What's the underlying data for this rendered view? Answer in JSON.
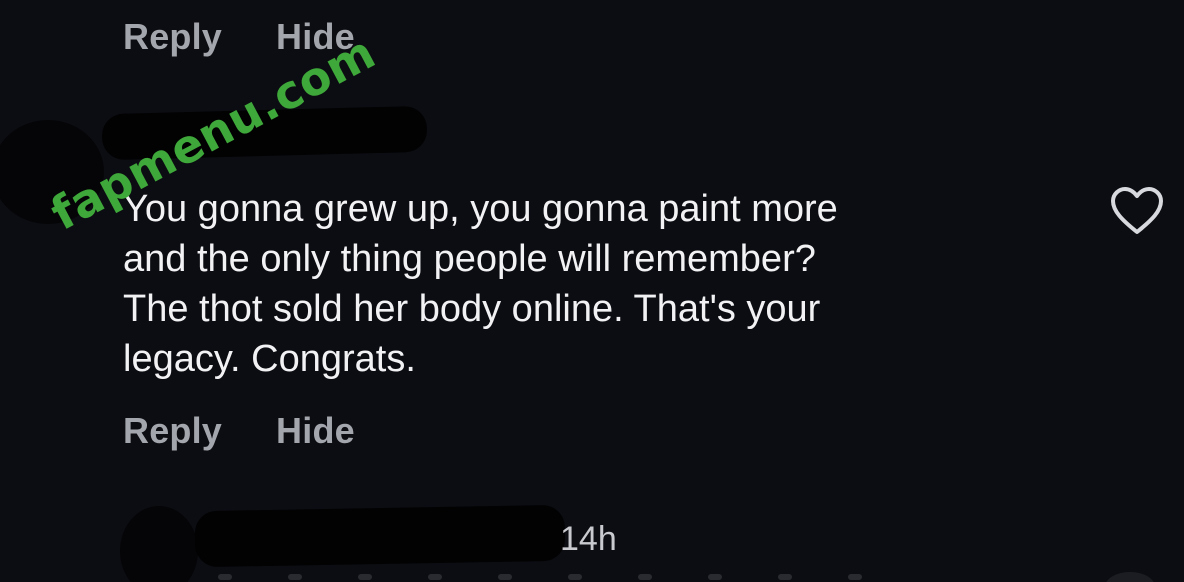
{
  "actions_top": {
    "reply": "Reply",
    "hide": "Hide"
  },
  "comment": {
    "text": "You gonna grew up, you gonna paint more\nand the only thing people will remember?\nThe thot sold her body online. That's your\nlegacy. Congrats."
  },
  "actions_mid": {
    "reply": "Reply",
    "hide": "Hide"
  },
  "next_comment": {
    "timestamp": "14h"
  },
  "watermark": {
    "text": "fapmenu.com",
    "color": "#3fa83a"
  },
  "icons": {
    "like": "heart-outline-icon"
  },
  "colors": {
    "background": "#0c0d12",
    "text": "#f2f2f4",
    "action": "#a4a6ad"
  }
}
